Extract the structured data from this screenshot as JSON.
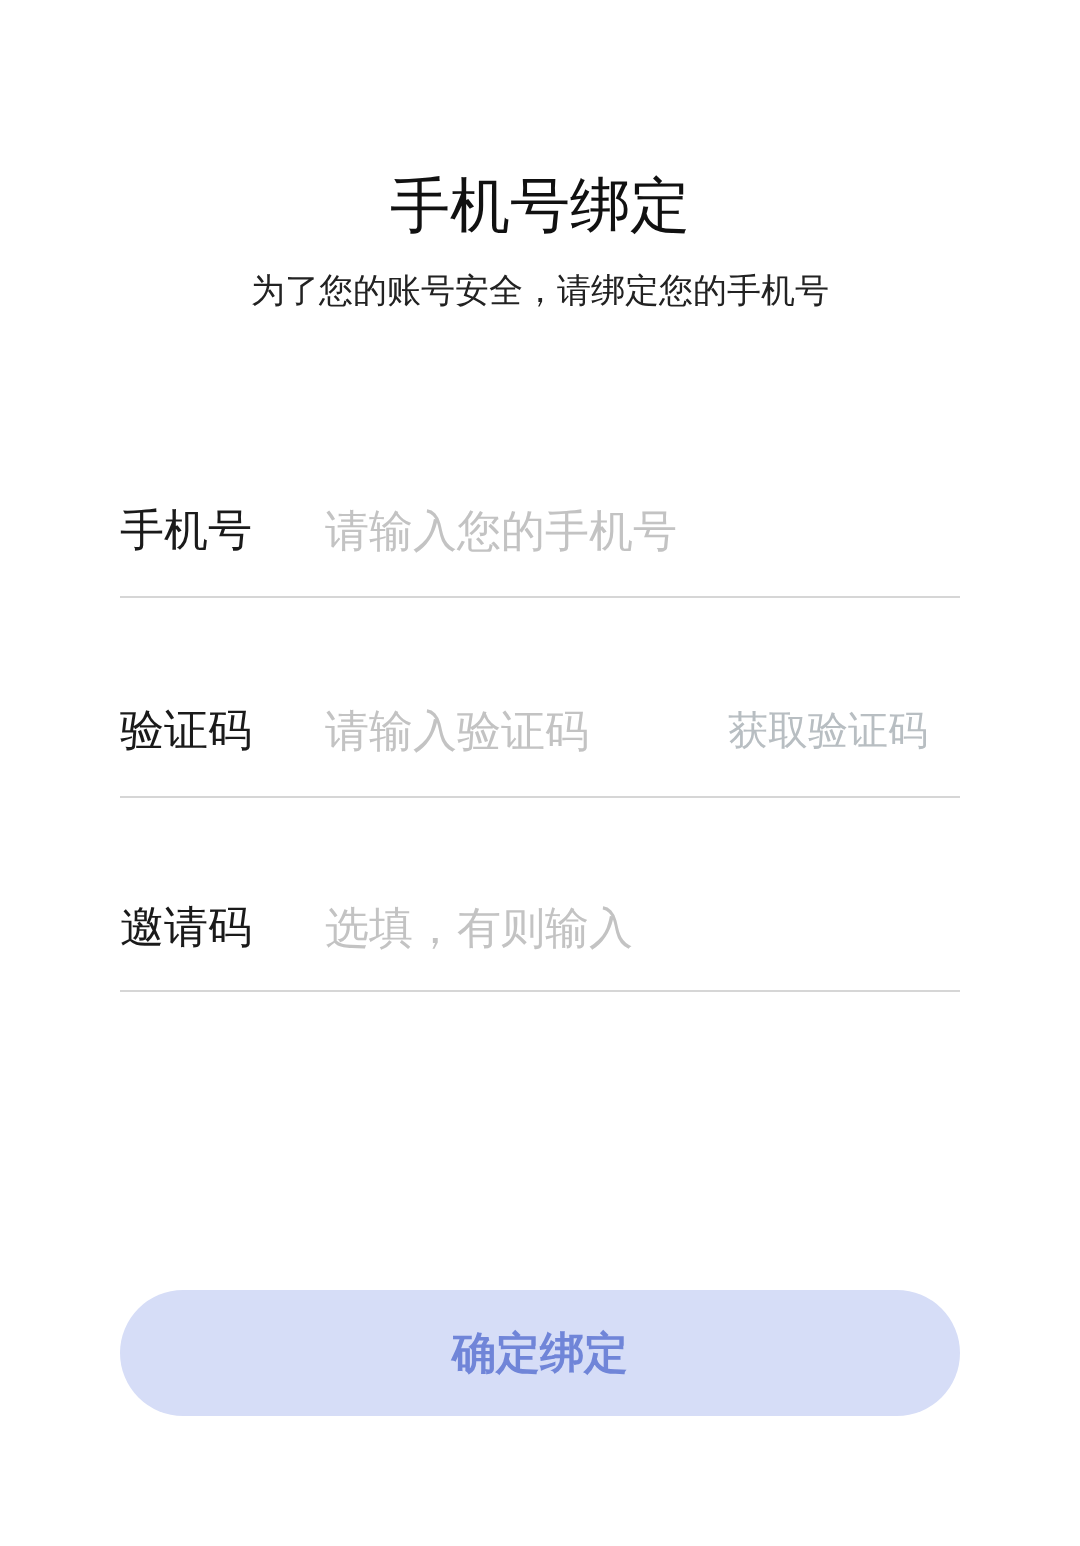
{
  "title": "手机号绑定",
  "subtitle": "为了您的账号安全，请绑定您的手机号",
  "fields": [
    {
      "label": "手机号",
      "placeholder": "请输入您的手机号"
    },
    {
      "label": "验证码",
      "placeholder": "请输入验证码",
      "action": {
        "label": "获取验证码"
      }
    },
    {
      "label": "邀请码",
      "placeholder": "选填，有则输入"
    }
  ],
  "submit": {
    "label": "确定绑定",
    "disabled": true
  }
}
